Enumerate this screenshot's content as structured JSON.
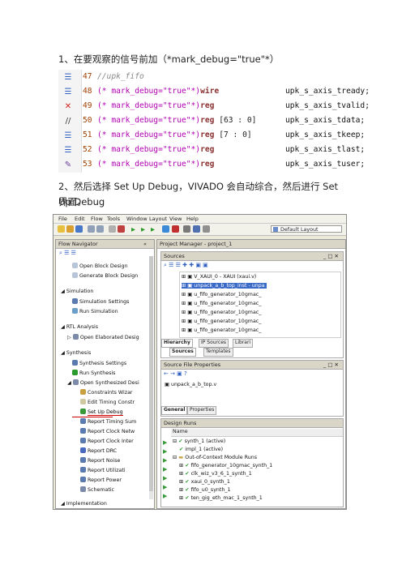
{
  "doc": {
    "step1": "1、在要观察的信号前加（*mark_debug=\"true\"*）",
    "step2_line1": "2、然后选择 Set Up Debug，VIVADO 会自动综合，然后进行 Set Up Debug",
    "step2_line2": "界面。"
  },
  "code": {
    "lines": [
      {
        "num": "47",
        "prefix": "//upk_fifo",
        "type": "",
        "width": "",
        "signal": ""
      },
      {
        "num": "48",
        "prefix": "(* mark_debug=\"true\"*)",
        "type": "wire",
        "width": "",
        "signal": "upk_s_axis_tready;"
      },
      {
        "num": "49",
        "prefix": "(* mark_debug=\"true\"*)",
        "type": "reg",
        "width": "",
        "signal": "upk_s_axis_tvalid;"
      },
      {
        "num": "50",
        "prefix": "(* mark_debug=\"true\"*)",
        "type": "reg",
        "width": "[63 : 0]",
        "signal": "upk_s_axis_tdata;"
      },
      {
        "num": "51",
        "prefix": "(* mark_debug=\"true\"*)",
        "type": "reg",
        "width": "[7 : 0]",
        "signal": "upk_s_axis_tkeep;"
      },
      {
        "num": "52",
        "prefix": "(* mark_debug=\"true\"*)",
        "type": "reg",
        "width": "",
        "signal": "upk_s_axis_tlast;"
      },
      {
        "num": "53",
        "prefix": "(* mark_debug=\"true\"*)",
        "type": "reg",
        "width": "",
        "signal": "upk_s_axis_tuser;"
      }
    ]
  },
  "ide": {
    "menu": [
      "File",
      "Edit",
      "Flow",
      "Tools",
      "Window",
      "Layout",
      "View",
      "Help"
    ],
    "layout_selector": "Default Layout",
    "flow_navigator_title": "Flow Navigator",
    "nav": {
      "open_block_design": "Open Block Design",
      "generate_block_design": "Generate Block Design",
      "simulation": "Simulation",
      "simulation_settings": "Simulation Settings",
      "run_simulation": "Run Simulation",
      "rtl_analysis": "RTL Analysis",
      "open_elaborated": "Open Elaborated Desig",
      "synthesis": "Synthesis",
      "synthesis_settings": "Synthesis Settings",
      "run_synthesis": "Run Synthesis",
      "open_synthesized": "Open Synthesized Desi",
      "constraints_wizard": "Constraints Wizar",
      "edit_timing": "Edit Timing Constr",
      "set_up_debug": "Set Up Debug",
      "report_timing": "Report Timing Sum",
      "report_clock_net": "Report Clock Netw",
      "report_clock_inter": "Report Clock Inter",
      "report_drc": "Report DRC",
      "report_noise": "Report Noise",
      "report_util": "Report Utilizati",
      "report_power": "Report Power",
      "schematic": "Schematic",
      "implementation": "Implementation"
    },
    "project_manager_title": "Project Manager - project_1",
    "sources_title": "Sources",
    "sources": [
      "V_XAUI_0 - XAUI (xaui.v)",
      "unpack_a_b_top_inst - unpa",
      "u_fifo_generator_10gmac_",
      "u_fifo_generator_10gmac_",
      "u_fifo_generator_10gmac_",
      "u_fifo_generator_10gmac_",
      "u_fifo_generator_10gmac_"
    ],
    "source_tabs": [
      "Hierarchy",
      "IP Sources",
      "Librari"
    ],
    "source_subtabs": [
      "Sources",
      "Templates"
    ],
    "sfp_title": "Source File Properties",
    "sfp_file": "unpack_a_b_top.v",
    "sfp_tabs": [
      "General",
      "Properties"
    ],
    "design_runs_title": "Design Runs",
    "runs_header": "Name",
    "runs": [
      "synth_1 (active)",
      "impl_1 (active)",
      "Out-of-Context Module Runs",
      "fifo_generator_10gmac_synth_1",
      "clk_wiz_v3_6_1_synth_1",
      "xaui_0_synth_1",
      "fifo_u0_synth_1",
      "ten_gig_eth_mac_1_synth_1"
    ]
  }
}
